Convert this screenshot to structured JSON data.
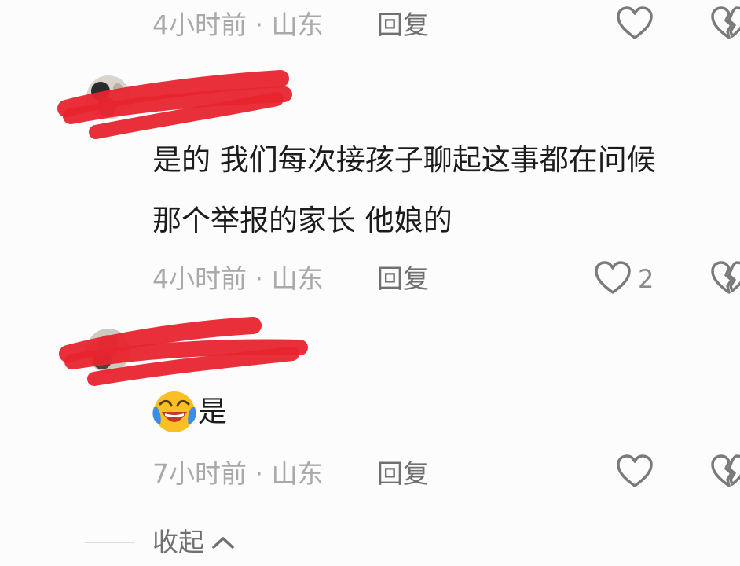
{
  "comments": [
    {
      "meta": "4小时前 · 山东",
      "reply": "回复",
      "like_count": ""
    },
    {
      "lines": [
        "是的 我们每次接孩子聊起这事都在问候",
        "那个举报的家长 他娘的"
      ],
      "meta": "4小时前 · 山东",
      "reply": "回复",
      "like_count": "2"
    },
    {
      "text": "是",
      "emoji": "laughing-crying-emoji",
      "meta": "7小时前 · 山东",
      "reply": "回复",
      "like_count": ""
    }
  ],
  "collapse_label": "收起",
  "icons": {
    "like": "heart-outline-icon",
    "dislike": "broken-heart-icon",
    "collapse": "chevron-up-icon"
  },
  "colors": {
    "background": "#fcfcfc",
    "meta_text": "#a9a9a9",
    "action_text": "#707070",
    "body_text": "#1c1c1c",
    "redaction": "#e8242e"
  }
}
